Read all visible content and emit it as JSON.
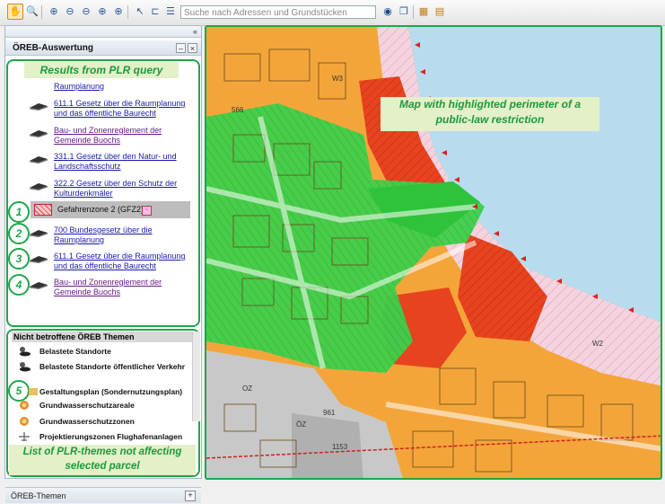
{
  "toolbar": {
    "search_placeholder": "Suche nach Adressen und Grundstücken",
    "icons": [
      "hand-icon",
      "zoom-rect-icon",
      "zoom-in-icon",
      "zoom-out-icon",
      "zoom-prev-icon",
      "zoom-next-icon",
      "zoom-full-icon",
      "select-icon",
      "identify-icon",
      "menu-icon",
      "globe-icon",
      "layers-icon",
      "export-icon",
      "print-icon"
    ]
  },
  "panel": {
    "collapse": "«",
    "title": "ÖREB-Auswertung",
    "minimize": "–",
    "close": "×"
  },
  "annotations": {
    "results": "Results from PLR query",
    "map": "Map with highlighted perimeter of a public-law restriction",
    "themes": "List of PLR-themes not affecting selected parcel"
  },
  "results": [
    {
      "text": "Raumplanung",
      "visited": false
    },
    {
      "text": "611.1 Gesetz über die Raumplanung und das öffentliche Baurecht",
      "visited": false
    },
    {
      "text": " Bau- und Zonenreglement der Gemeinde Buochs",
      "visited": true
    },
    {
      "text": "331.1 Gesetz über den Natur- und Landschaftsschutz",
      "visited": false
    },
    {
      "text": "322.2 Gesetz über den Schutz der Kulturdenkmäler",
      "visited": false
    }
  ],
  "selected_item": {
    "label": "Gefahrenzone 2 (GFZ2)"
  },
  "numbered": [
    {
      "n": "1"
    },
    {
      "n": "2",
      "text": "700 Bundesgesetz über die Raumplanung",
      "visited": false
    },
    {
      "n": "3",
      "text": "611.1 Gesetz über die Raumplanung und das öffentliche Baurecht",
      "visited": false
    },
    {
      "n": "4",
      "text": " Bau- und Zonenreglement der Gemeinde Buochs",
      "visited": true
    },
    {
      "n": "5"
    }
  ],
  "not_affected": {
    "header": "Nicht betroffene ÖREB Themen",
    "items": [
      "Belastete Standorte",
      "Belastete Standorte öffentlicher Verkehr",
      "Gestaltungsplan (Sondernutzungsplan)",
      "Grundwasserschutzareale",
      "Grundwasserschutzzonen",
      "Projektierungszonen Flughafenanlagen"
    ]
  },
  "bottom": {
    "label": "ÖREB-Themen",
    "plus": "+"
  },
  "map": {
    "parcel_labels": [
      "566",
      "W3",
      "OZ",
      "W2",
      "ÖZ",
      "961",
      "1153"
    ],
    "colors": {
      "zone_orange": "#f4a53a",
      "zone_red": "#e8431f",
      "highlight_green": "#3ecf4a",
      "lake": "#b8dcee",
      "hatch_pink": "#f3c8d8"
    }
  }
}
